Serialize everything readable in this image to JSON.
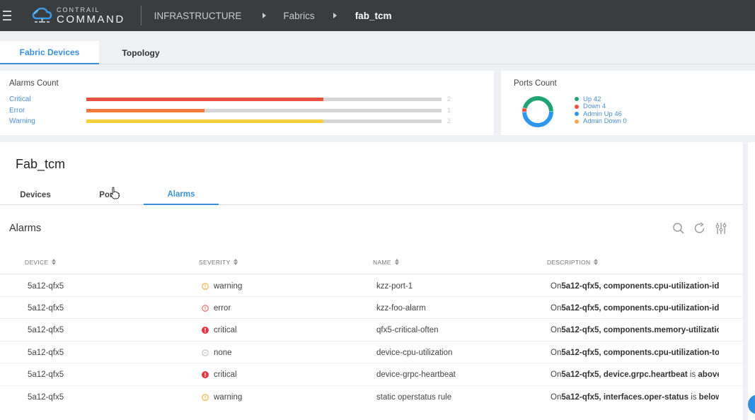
{
  "topbar": {
    "logo_small": "CONTRAIL",
    "logo_big": "COMMAND",
    "breadcrumbs": [
      "INFRASTRUCTURE",
      "Fabrics",
      "fab_tcm"
    ]
  },
  "page_tabs": [
    {
      "label": "Fabric Devices",
      "active": true
    },
    {
      "label": "Topology",
      "active": false
    }
  ],
  "alarms_count": {
    "title": "Alarms Count",
    "max": 3,
    "items": [
      {
        "label": "Critical",
        "value": 2,
        "value_text": "2",
        "color": "#e8533f"
      },
      {
        "label": "Error",
        "value": 1,
        "value_text": "1",
        "color": "#f47c3c"
      },
      {
        "label": "Warning",
        "value": 2,
        "value_text": "2",
        "color": "#fdd03b"
      }
    ]
  },
  "ports_count": {
    "title": "Ports Count",
    "items": [
      {
        "label": "Up 42",
        "value": 42,
        "color": "#21a274"
      },
      {
        "label": "Down 4",
        "value": 4,
        "color": "#f04e3e"
      },
      {
        "label": "Admin Up 46",
        "value": 46,
        "color": "#2d96ef"
      },
      {
        "label": "Admin Down 0",
        "value": 0,
        "color": "#f7a84a"
      }
    ]
  },
  "fabric": {
    "title": "Fab_tcm",
    "tabs": [
      {
        "label": "Devices",
        "active": false
      },
      {
        "label": "Ports",
        "active": false
      },
      {
        "label": "Alarms",
        "active": true
      }
    ]
  },
  "alarms_table": {
    "title": "Alarms",
    "columns": [
      "DEVICE",
      "SEVERITY",
      "NAME",
      "DESCRIPTION"
    ],
    "rows": [
      {
        "device": "5a12-qfx5",
        "severity": "warning",
        "name": "kzz-port-1",
        "desc_prefix": "On ",
        "desc_device": "5a12-qfx5,",
        "desc_metric": "components.cpu-utilization-idl",
        "desc_suffix": ""
      },
      {
        "device": "5a12-qfx5",
        "severity": "error",
        "name": "kzz-foo-alarm",
        "desc_prefix": "On ",
        "desc_device": "5a12-qfx5,",
        "desc_metric": "components.cpu-utilization-idl",
        "desc_suffix": ""
      },
      {
        "device": "5a12-qfx5",
        "severity": "critical",
        "name": "qfx5-critical-often",
        "desc_prefix": "On ",
        "desc_device": "5a12-qfx5,",
        "desc_metric": "components.memory-utilizatio",
        "desc_suffix": ""
      },
      {
        "device": "5a12-qfx5",
        "severity": "none",
        "name": "device-cpu-utilization",
        "desc_prefix": "On ",
        "desc_device": "5a12-qfx5,",
        "desc_metric": "components.cpu-utilization-tot",
        "desc_suffix": ""
      },
      {
        "device": "5a12-qfx5",
        "severity": "critical",
        "name": "device-grpc-heartbeat",
        "desc_prefix": "On ",
        "desc_device": "5a12-qfx5,",
        "desc_metric": "device.grpc.heartbeat",
        "desc_suffix": " is ",
        "desc_tail": "above"
      },
      {
        "device": "5a12-qfx5",
        "severity": "warning",
        "name": "static operstatus rule",
        "desc_prefix": "On ",
        "desc_device": "5a12-qfx5,",
        "desc_metric": "interfaces.oper-status",
        "desc_suffix": " is ",
        "desc_tail": "below"
      }
    ]
  },
  "icons": {
    "menu": "hamburger-icon",
    "search": "search-icon",
    "refresh": "refresh-icon",
    "settings": "sliders-icon"
  },
  "severity_colors": {
    "warning": "#f2a93b",
    "error": "#e8625a",
    "critical": "#e8343f",
    "none": "#b9bcbf"
  }
}
